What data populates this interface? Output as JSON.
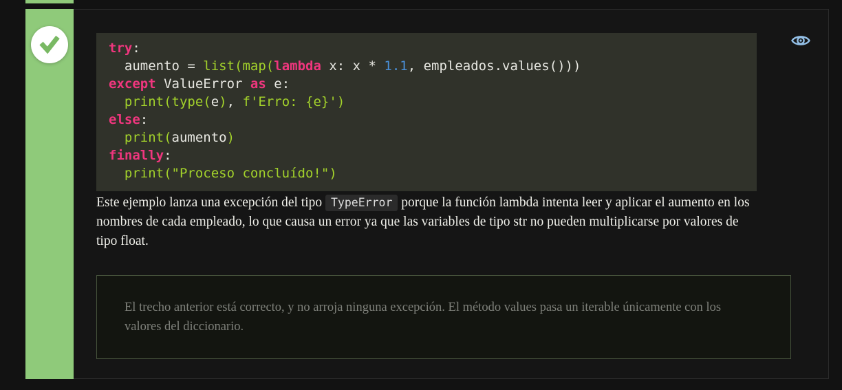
{
  "colors": {
    "accent_green": "#8fca7a",
    "check_green": "#79b963",
    "keyword_pink": "#f0367e",
    "builtin_green": "#a3d22b",
    "number_blue": "#4a90d9",
    "eye_blue": "#93bfe6",
    "code_background": "#30322a",
    "answer_border_green": "#46523c"
  },
  "icons": {
    "status": "check-icon",
    "reveal": "eye-icon"
  },
  "code_block": {
    "language": "python",
    "lines": [
      {
        "tokens": [
          {
            "type": "kw",
            "text": "try"
          },
          {
            "type": "plain",
            "text": ":"
          }
        ]
      },
      {
        "tokens": [
          {
            "type": "plain",
            "text": "  aumento = "
          },
          {
            "type": "fn",
            "text": "list("
          },
          {
            "type": "fn",
            "text": "map("
          },
          {
            "type": "kw",
            "text": "lambda"
          },
          {
            "type": "plain",
            "text": " x: x * "
          },
          {
            "type": "num",
            "text": "1.1"
          },
          {
            "type": "plain",
            "text": ", empleados.values()))"
          }
        ]
      },
      {
        "tokens": [
          {
            "type": "kw",
            "text": "except"
          },
          {
            "type": "plain",
            "text": " ValueError "
          },
          {
            "type": "kw",
            "text": "as"
          },
          {
            "type": "plain",
            "text": " e:"
          }
        ]
      },
      {
        "tokens": [
          {
            "type": "plain",
            "text": "  "
          },
          {
            "type": "fn",
            "text": "print("
          },
          {
            "type": "fn",
            "text": "type("
          },
          {
            "type": "plain",
            "text": "e"
          },
          {
            "type": "fn",
            "text": ")"
          },
          {
            "type": "plain",
            "text": ", "
          },
          {
            "type": "str",
            "text": "f'Erro: {e}'"
          },
          {
            "type": "fn",
            "text": ")"
          }
        ]
      },
      {
        "tokens": [
          {
            "type": "kw",
            "text": "else"
          },
          {
            "type": "plain",
            "text": ":"
          }
        ]
      },
      {
        "tokens": [
          {
            "type": "plain",
            "text": "  "
          },
          {
            "type": "fn",
            "text": "print("
          },
          {
            "type": "plain",
            "text": "aumento"
          },
          {
            "type": "fn",
            "text": ")"
          }
        ]
      },
      {
        "tokens": [
          {
            "type": "kw",
            "text": "finally"
          },
          {
            "type": "plain",
            "text": ":"
          }
        ]
      },
      {
        "tokens": [
          {
            "type": "plain",
            "text": "  "
          },
          {
            "type": "fn",
            "text": "print("
          },
          {
            "type": "str",
            "text": "\"Proceso concluído!\""
          },
          {
            "type": "fn",
            "text": ")"
          }
        ]
      }
    ]
  },
  "explanation": {
    "before_code": "Este ejemplo lanza una excepción del tipo ",
    "inline_code": "TypeError",
    "after_code": " porque la función lambda intenta leer y aplicar el aumento en los nombres de cada empleado, lo que causa un error ya que las variables de tipo str no pueden multiplicarse por valores de tipo float."
  },
  "answer": {
    "text": "El trecho anterior está correcto, y no arroja ninguna excepción. El método values pasa un iterable únicamente con los valores del diccionario."
  }
}
